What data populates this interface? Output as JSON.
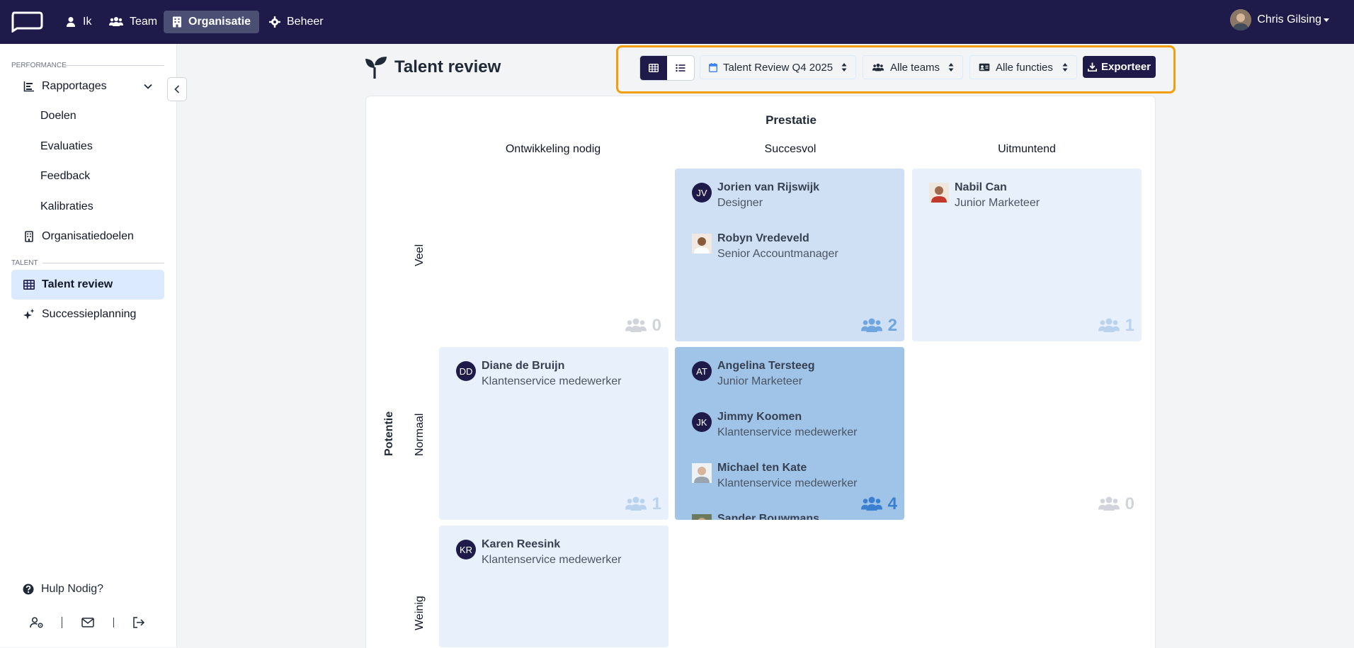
{
  "topbar": {
    "nav": [
      {
        "label": "Ik",
        "icon": "user-icon"
      },
      {
        "label": "Team",
        "icon": "users-icon"
      },
      {
        "label": "Organisatie",
        "icon": "building-icon"
      },
      {
        "label": "Beheer",
        "icon": "gear-icon"
      }
    ],
    "user_name": "Chris Gilsing"
  },
  "sidebar": {
    "performance_label": "PERFORMANCE",
    "items": [
      {
        "label": "Rapportages"
      },
      {
        "label": "Doelen"
      },
      {
        "label": "Evaluaties"
      },
      {
        "label": "Feedback"
      },
      {
        "label": "Kalibraties"
      },
      {
        "label": "Organisatiedoelen"
      }
    ],
    "talent_label": "TALENT",
    "talent_items": [
      {
        "label": "Talent review"
      },
      {
        "label": "Successieplanning"
      }
    ],
    "help": "Hulp Nodig?"
  },
  "page": {
    "title": "Talent review",
    "filters": {
      "review": "Talent Review Q4 2025",
      "teams": "Alle teams",
      "functions": "Alle functies"
    },
    "export_label": "Exporteer"
  },
  "grid": {
    "x_title": "Prestatie",
    "y_title": "Potentie",
    "columns": [
      "Ontwikkeling nodig",
      "Succesvol",
      "Uitmuntend"
    ],
    "rows": [
      "Veel",
      "Normaal",
      "Weinig"
    ],
    "cells": {
      "veel_ontwikkeling": {
        "count": "0",
        "people": []
      },
      "veel_succesvol": {
        "count": "2",
        "people": [
          {
            "initials": "JV",
            "name": "Jorien van Rijswijk",
            "role": "Designer"
          },
          {
            "initials": "",
            "name": "Robyn Vredeveld",
            "role": "Senior Accountmanager"
          }
        ]
      },
      "veel_uitmuntend": {
        "count": "1",
        "people": [
          {
            "initials": "",
            "name": "Nabil Can",
            "role": "Junior Marketeer"
          }
        ]
      },
      "normaal_ontwikkeling": {
        "count": "1",
        "people": [
          {
            "initials": "DD",
            "name": "Diane de Bruijn",
            "role": "Klantenservice medewerker"
          }
        ]
      },
      "normaal_succesvol": {
        "count": "4",
        "people": [
          {
            "initials": "AT",
            "name": "Angelina Tersteeg",
            "role": "Junior Marketeer"
          },
          {
            "initials": "JK",
            "name": "Jimmy Koomen",
            "role": "Klantenservice medewerker"
          },
          {
            "initials": "",
            "name": "Michael ten Kate",
            "role": "Klantenservice medewerker"
          },
          {
            "initials": "",
            "name": "Sander Bouwmans",
            "role": ""
          }
        ]
      },
      "normaal_uitmuntend": {
        "count": "0",
        "people": []
      },
      "weinig_ontwikkeling": {
        "count": "",
        "people": [
          {
            "initials": "KR",
            "name": "Karen Reesink",
            "role": "Klantenservice medewerker"
          }
        ]
      }
    }
  },
  "colors": {
    "navy": "#1e1b4b",
    "accent": "#f59e0b",
    "cell_light": "#e8f0fb",
    "cell_mid": "#cfe0f5",
    "cell_dark": "#a0c4e8"
  }
}
